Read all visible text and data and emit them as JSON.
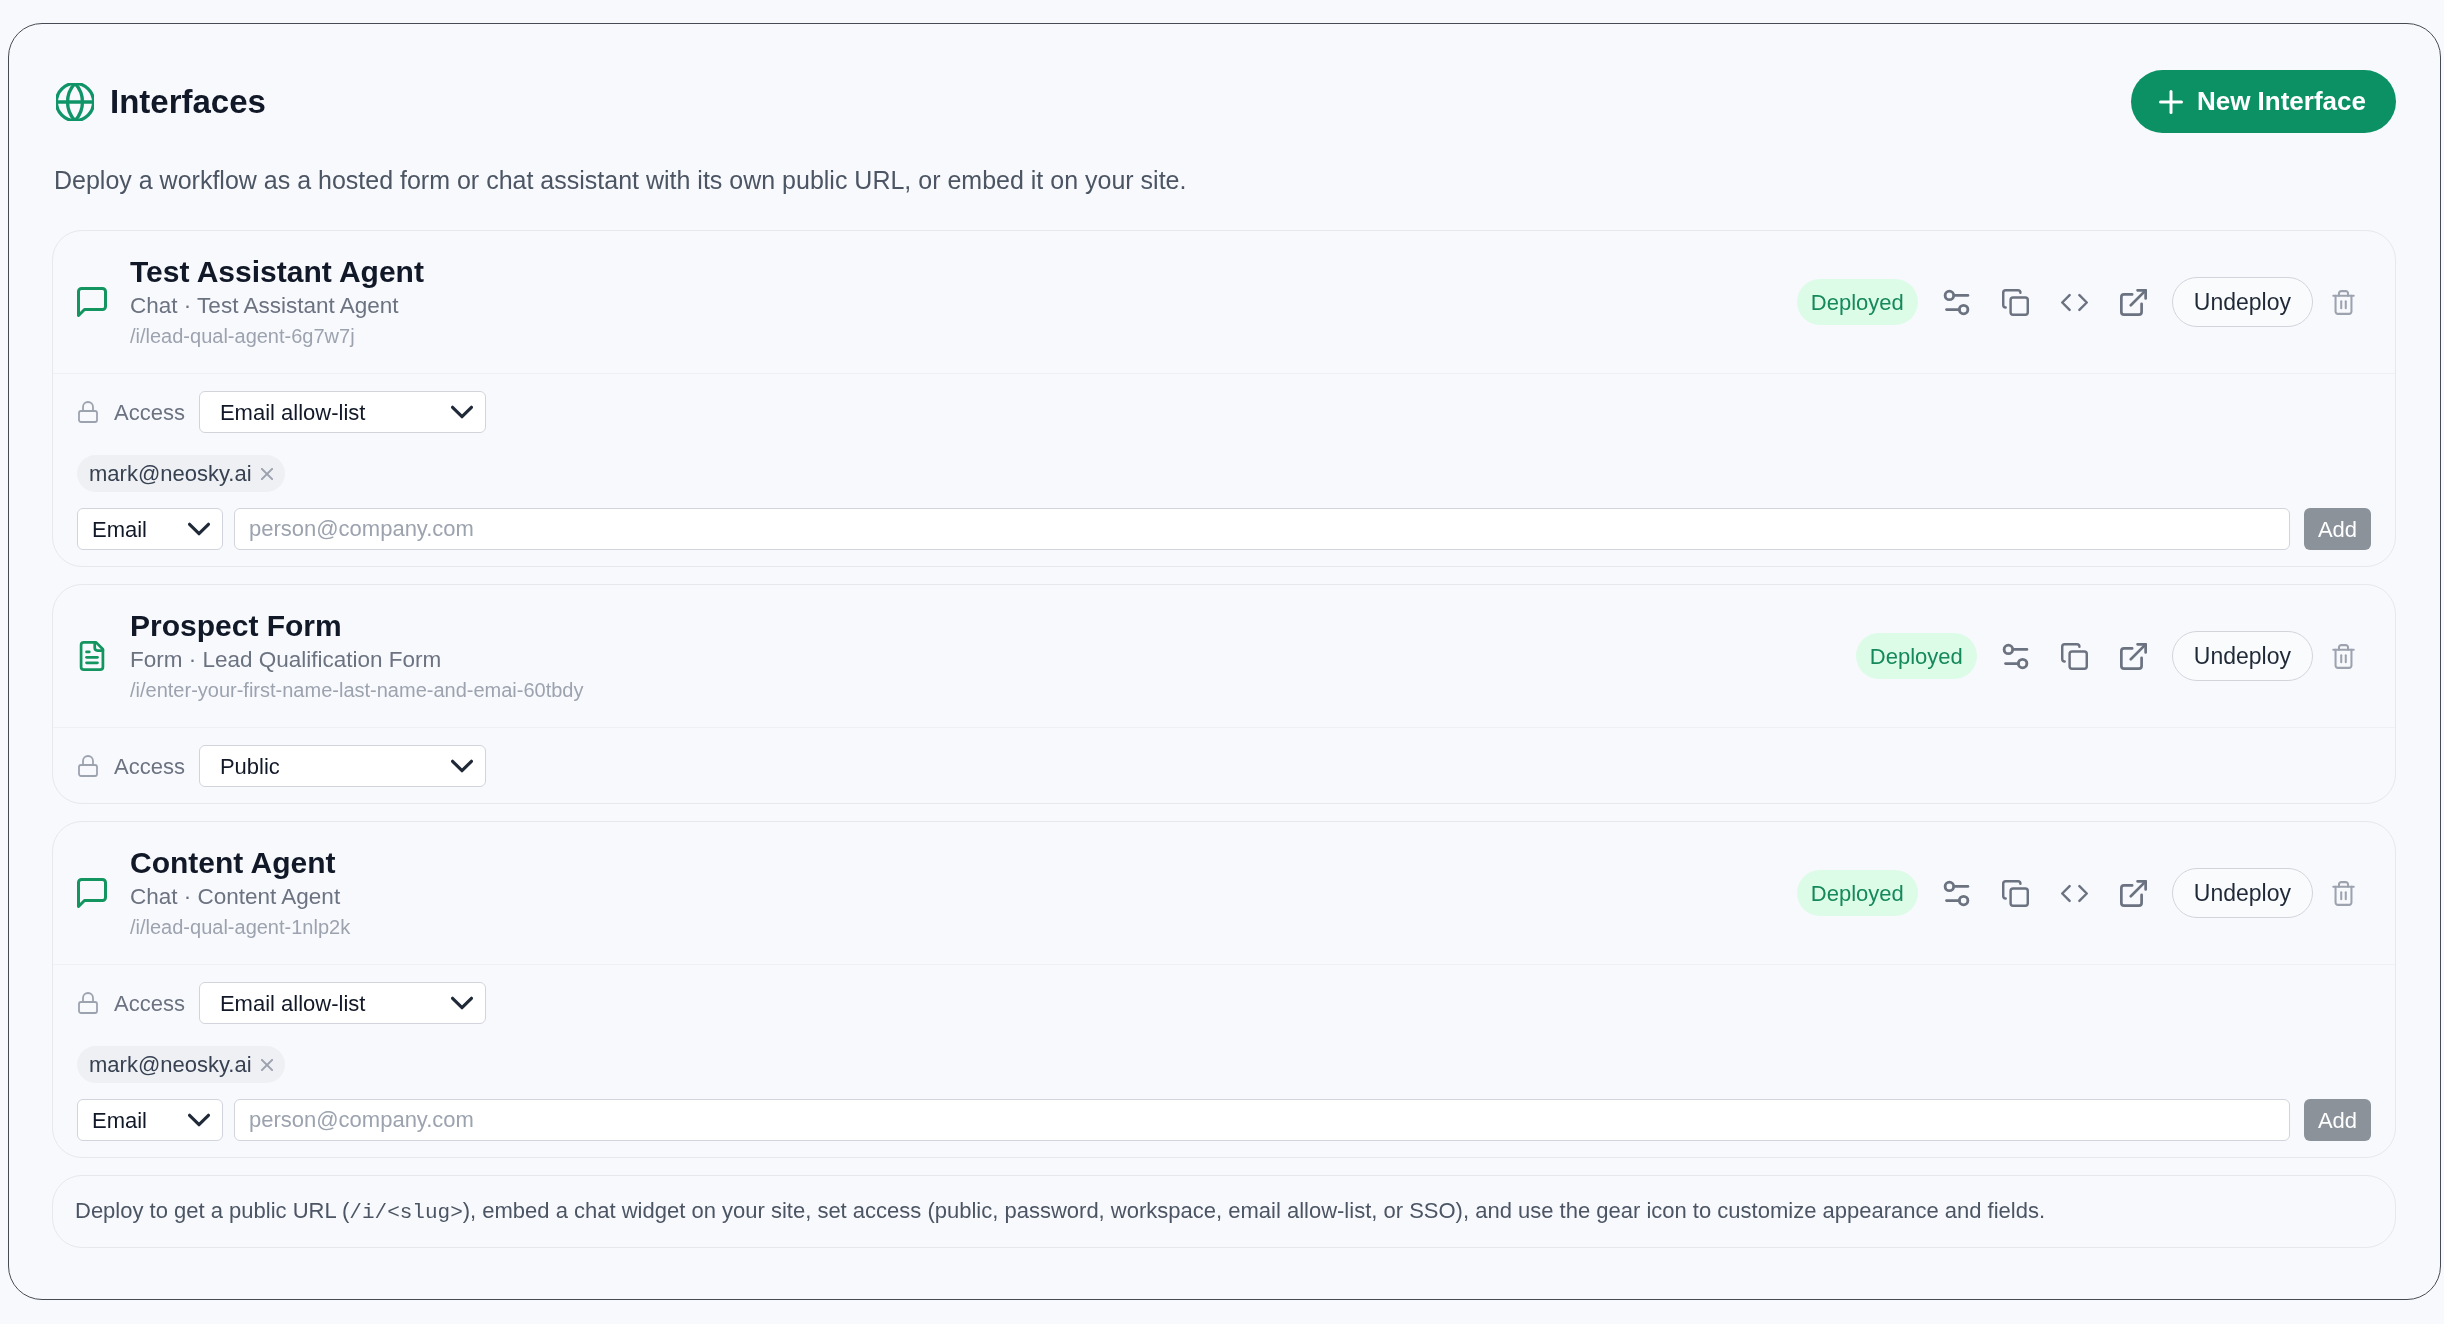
{
  "header": {
    "title": "Interfaces",
    "new_button": "New Interface",
    "description": "Deploy a workflow as a hosted form or chat assistant with its own public URL, or embed it on your site."
  },
  "interfaces": [
    {
      "kind": "chat",
      "name": "Test Assistant Agent",
      "subtitle": "Chat · Test Assistant Agent",
      "slug": "/i/lead-qual-agent-6g7w7j",
      "status": "Deployed",
      "embed": true,
      "undeploy_button": "Undeploy",
      "access": {
        "label": "Access",
        "value": "Email allow-list"
      },
      "allow_list": {
        "entries": [
          {
            "email": "mark@neosky.ai"
          }
        ],
        "type": "Email",
        "placeholder": "person@company.com",
        "add_button": "Add",
        "add_disabled": true
      }
    },
    {
      "kind": "form",
      "name": "Prospect Form",
      "subtitle": "Form · Lead Qualification Form",
      "slug": "/i/enter-your-first-name-last-name-and-emai-60tbdy",
      "status": "Deployed",
      "embed": false,
      "undeploy_button": "Undeploy",
      "access": {
        "label": "Access",
        "value": "Public"
      }
    },
    {
      "kind": "chat",
      "name": "Content Agent",
      "subtitle": "Chat · Content Agent",
      "slug": "/i/lead-qual-agent-1nlp2k",
      "status": "Deployed",
      "embed": true,
      "undeploy_button": "Undeploy",
      "access": {
        "label": "Access",
        "value": "Email allow-list"
      },
      "allow_list": {
        "entries": [
          {
            "email": "mark@neosky.ai"
          }
        ],
        "type": "Email",
        "placeholder": "person@company.com",
        "add_button": "Add",
        "add_disabled": true
      }
    }
  ],
  "note": {
    "parts": [
      {
        "kind": "text",
        "text": "Deploy to get a public URL ("
      },
      {
        "kind": "code",
        "text": "/i/<slug>"
      },
      {
        "kind": "text",
        "text": "), embed a chat widget on your site, set access (public, password, workspace, email allow-list, or SSO), and use the gear icon to customize appearance and fields."
      }
    ]
  }
}
